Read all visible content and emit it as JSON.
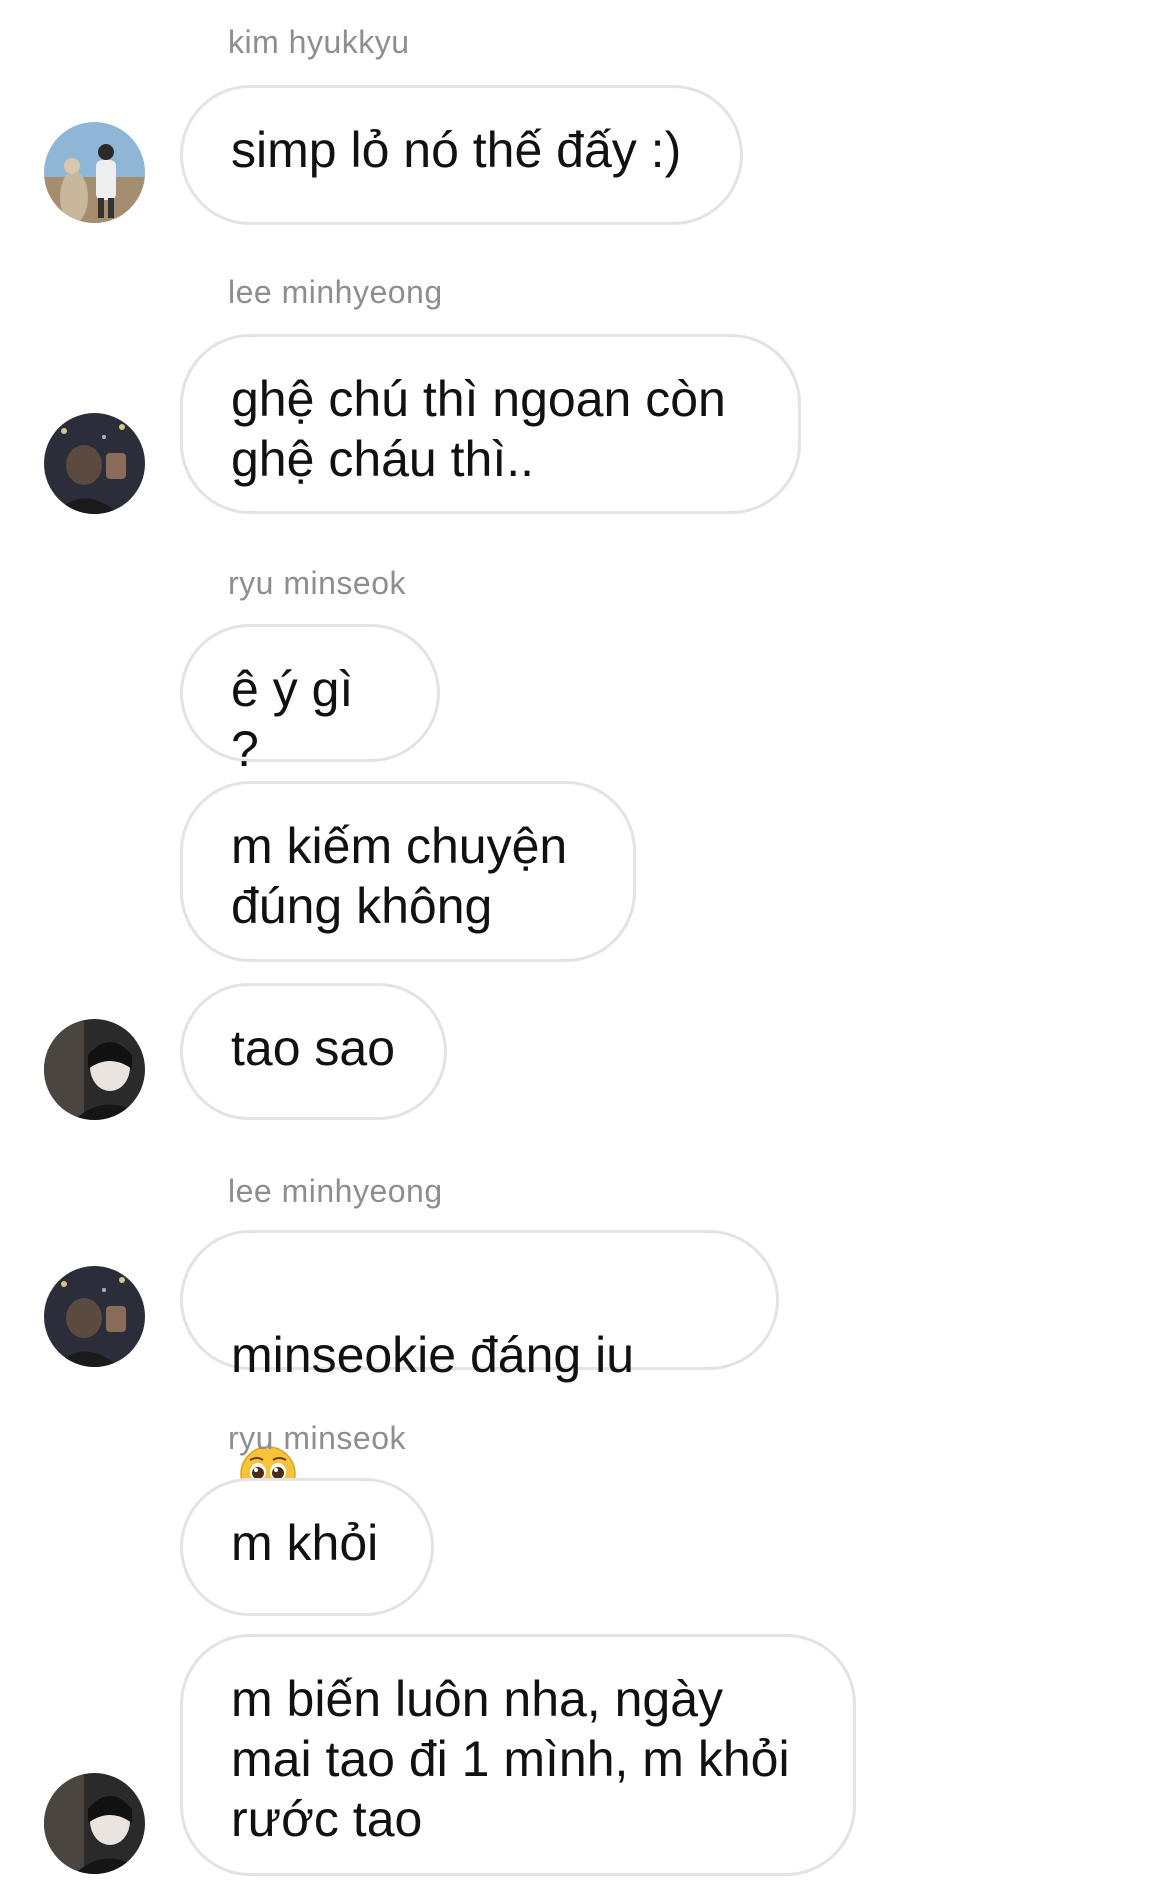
{
  "messages": [
    {
      "sender": "kim hyukkyu",
      "text": "simp lỏ nó thế đấy :)"
    },
    {
      "sender": "lee minhyeong",
      "text": "ghệ chú thì ngoan còn\nghệ cháu thì.."
    },
    {
      "sender": "ryu minseok",
      "texts": [
        "ê ý gì ?",
        "m kiếm chuyện\nđúng không",
        "tao sao"
      ]
    },
    {
      "sender": "lee minhyeong",
      "text": "minseokie đáng iu",
      "emoji": "pleading-face"
    },
    {
      "sender": "ryu minseok",
      "texts": [
        "m khỏi",
        "m biến luôn nha, ngày\nmai tao đi 1 mình, m khỏi\nrước tao"
      ]
    }
  ],
  "colors": {
    "sender_name": "#8e8e8e",
    "bubble_border": "#e3e3e3",
    "text": "#111111"
  }
}
